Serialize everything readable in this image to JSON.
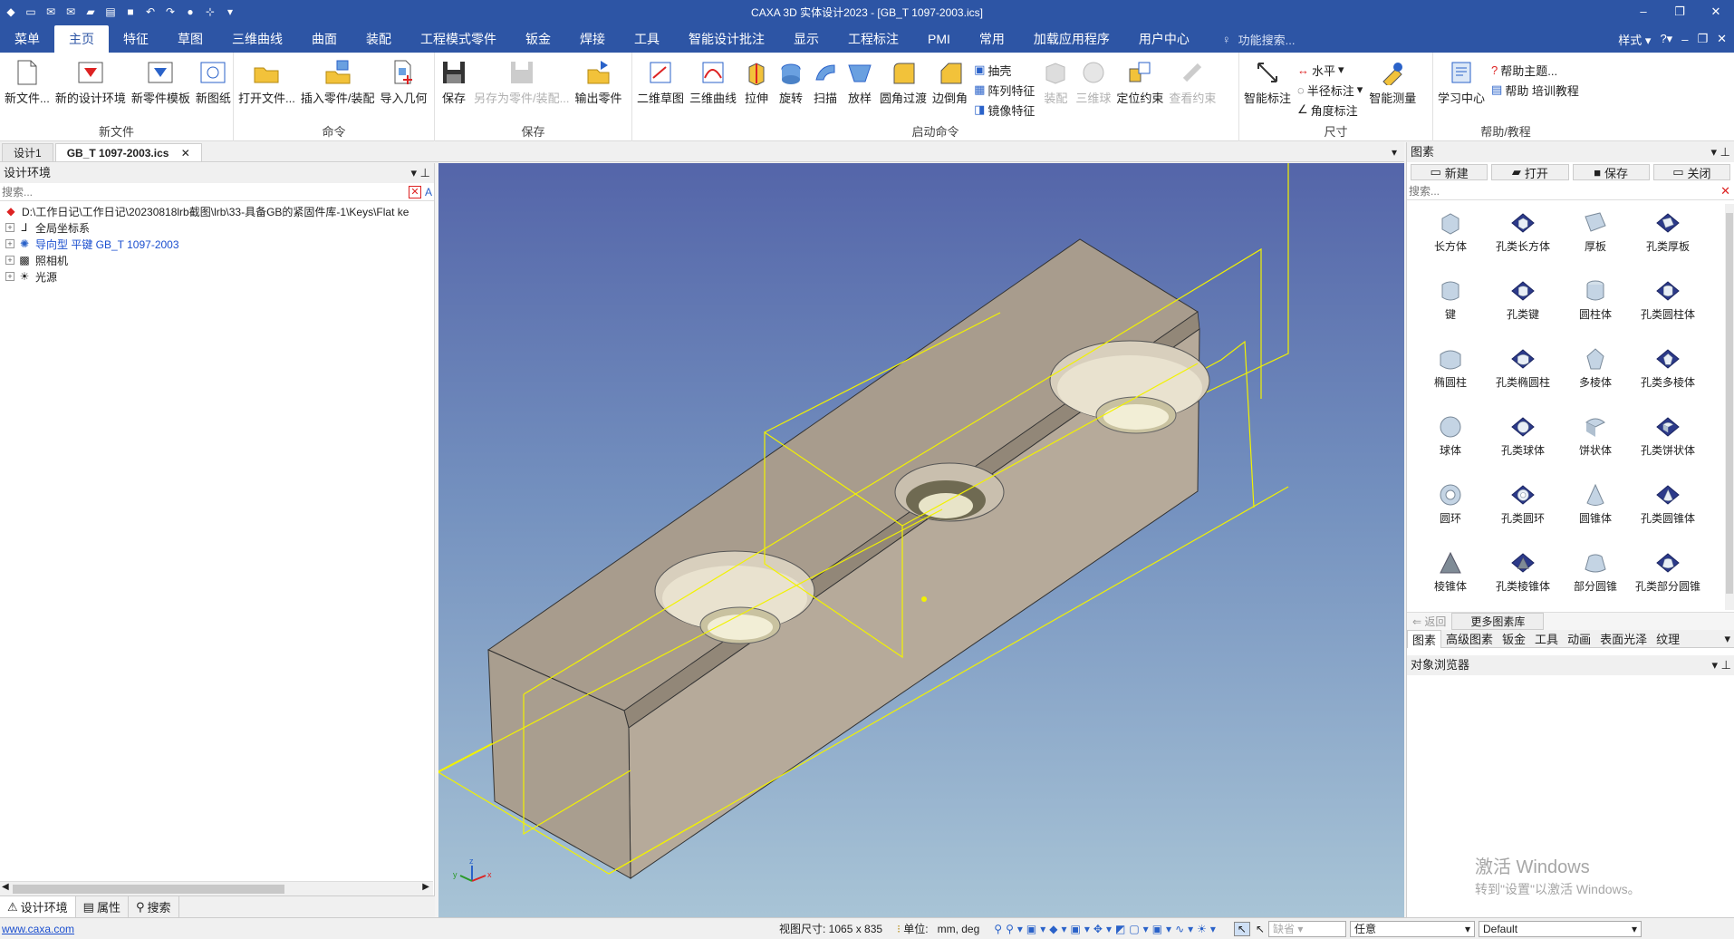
{
  "window": {
    "title": "CAXA 3D 实体设计2023 - [GB_T 1097-2003.ics]"
  },
  "menu": {
    "tabs": [
      "菜单",
      "主页",
      "特征",
      "草图",
      "三维曲线",
      "曲面",
      "装配",
      "工程模式零件",
      "钣金",
      "焊接",
      "工具",
      "智能设计批注",
      "显示",
      "工程标注",
      "PMI",
      "常用",
      "加载应用程序",
      "用户中心"
    ],
    "active_tab": "主页",
    "search_placeholder": "功能搜索...",
    "style_label": "样式"
  },
  "ribbon": {
    "groups": {
      "new_file": {
        "label": "新文件",
        "buttons": [
          "新文件...",
          "新的设计环境",
          "新零件模板",
          "新图纸"
        ]
      },
      "command": {
        "label": "命令",
        "buttons": [
          "打开文件...",
          "插入零件/装配",
          "导入几何"
        ]
      },
      "save": {
        "label": "保存",
        "buttons": [
          "保存",
          "另存为零件/装配...",
          "输出零件"
        ]
      },
      "start": {
        "label": "启动命令",
        "buttons": [
          "二维草图",
          "三维曲线",
          "拉伸",
          "旋转",
          "扫描",
          "放样",
          "圆角过渡",
          "边倒角"
        ],
        "small": [
          "抽壳",
          "阵列特征",
          "镜像特征"
        ],
        "disabled_buttons": [
          "装配",
          "三维球"
        ],
        "more_buttons": [
          "定位约束"
        ],
        "disabled_more": [
          "查看约束"
        ]
      },
      "dimension": {
        "label": "尺寸",
        "buttons": [
          "智能标注"
        ],
        "small": [
          "水平",
          "半径标注",
          "角度标注"
        ],
        "measure": "智能测量"
      },
      "help": {
        "label": "帮助/教程",
        "buttons": [
          "学习中心"
        ],
        "small": [
          "帮助主题...",
          "帮助 培训教程"
        ]
      }
    }
  },
  "doc_tabs": [
    "设计1",
    "GB_T 1097-2003.ics"
  ],
  "design_env": {
    "title": "设计环境",
    "search_placeholder": "搜索...",
    "path": "D:\\工作日记\\工作日记\\20230818lrb截图\\lrb\\33-具备GB的紧固件库-1\\Keys\\Flat ke",
    "tree": [
      {
        "label": "全局坐标系",
        "color": "normal"
      },
      {
        "label": "导向型 平键 GB_T 1097-2003",
        "color": "blue"
      },
      {
        "label": "照相机",
        "color": "normal"
      },
      {
        "label": "光源",
        "color": "normal"
      }
    ],
    "bottom_tabs": [
      "设计环境",
      "属性",
      "搜索"
    ]
  },
  "catalog": {
    "title": "图素",
    "toolbar": [
      "新建",
      "打开",
      "保存",
      "关闭"
    ],
    "search_placeholder": "搜索...",
    "items": [
      {
        "label": "长方体",
        "shape": "box"
      },
      {
        "label": "孔类长方体",
        "shape": "hole-box"
      },
      {
        "label": "厚板",
        "shape": "plate"
      },
      {
        "label": "孔类厚板",
        "shape": "hole-plate"
      },
      {
        "label": "键",
        "shape": "key"
      },
      {
        "label": "孔类键",
        "shape": "hole-key"
      },
      {
        "label": "圆柱体",
        "shape": "cylinder"
      },
      {
        "label": "孔类圆柱体",
        "shape": "hole-cylinder"
      },
      {
        "label": "椭圆柱",
        "shape": "ellipse"
      },
      {
        "label": "孔类椭圆柱",
        "shape": "hole-ellipse"
      },
      {
        "label": "多棱体",
        "shape": "prism"
      },
      {
        "label": "孔类多棱体",
        "shape": "hole-prism"
      },
      {
        "label": "球体",
        "shape": "sphere"
      },
      {
        "label": "孔类球体",
        "shape": "hole-sphere"
      },
      {
        "label": "饼状体",
        "shape": "pie"
      },
      {
        "label": "孔类饼状体",
        "shape": "hole-pie"
      },
      {
        "label": "圆环",
        "shape": "torus"
      },
      {
        "label": "孔类圆环",
        "shape": "hole-torus"
      },
      {
        "label": "圆锥体",
        "shape": "cone"
      },
      {
        "label": "孔类圆锥体",
        "shape": "hole-cone"
      },
      {
        "label": "棱锥体",
        "shape": "pyramid"
      },
      {
        "label": "孔类棱锥体",
        "shape": "hole-pyramid"
      },
      {
        "label": "部分圆锥",
        "shape": "partial-cone"
      },
      {
        "label": "孔类部分圆锥",
        "shape": "hole-partial-cone"
      }
    ],
    "back": "返回",
    "more": "更多图素库",
    "categories": [
      "图素",
      "高级图素",
      "钣金",
      "工具",
      "动画",
      "表面光泽",
      "纹理"
    ],
    "object_browser": "对象浏览器"
  },
  "activation": {
    "line1": "激活 Windows",
    "line2": "转到\"设置\"以激活 Windows。"
  },
  "status": {
    "link": "www.caxa.com",
    "view_size": "视图尺寸: 1065 x  835",
    "unit_label": "单位:",
    "unit_value": "mm, deg",
    "snap": "缺省",
    "filter": "任意",
    "scheme": "Default"
  },
  "colors": {
    "title_blue": "#2d55a5",
    "part_face": "#b8aa98",
    "part_top": "#a79c8c",
    "highlight_yellow": "#f2f200"
  }
}
